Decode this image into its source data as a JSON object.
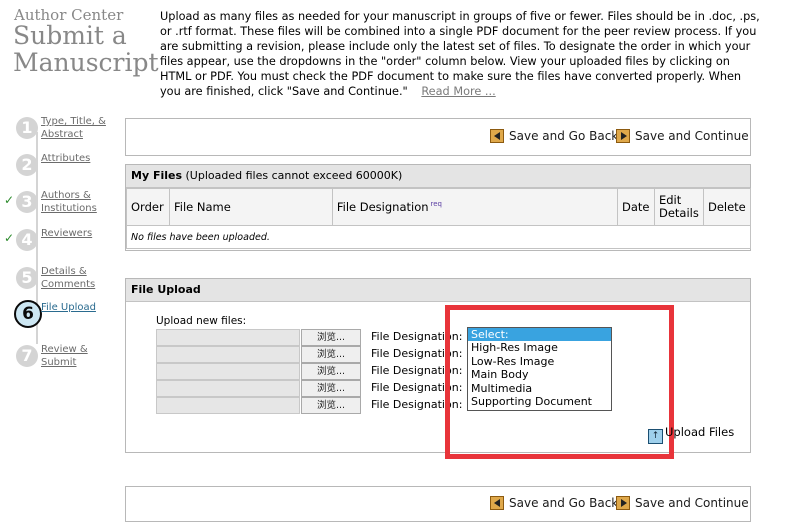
{
  "header": {
    "brand_small": "Author Center",
    "brand_line1": "Submit a",
    "brand_line2": "Manuscript",
    "intro_text": "Upload as many files as needed for your manuscript in groups of five or fewer. Files should be in .doc, .ps, or .rtf format. These files will be combined into a single PDF document for the peer review process. If you are submitting a revision, please include only the latest set of files. To designate the order in which your files appear, use the dropdowns in the \"order\" column below. View your uploaded files by clicking on HTML or PDF. You must check the PDF document to make sure the files have converted properly. When you are finished, click \"Save and Continue.\"",
    "read_more": "Read More ..."
  },
  "steps": [
    {
      "number": "1",
      "label": "Type, Title, & Abstract",
      "checked": false
    },
    {
      "number": "2",
      "label": "Attributes",
      "checked": false
    },
    {
      "number": "3",
      "label": "Authors & Institutions",
      "checked": true
    },
    {
      "number": "4",
      "label": "Reviewers",
      "checked": true
    },
    {
      "number": "5",
      "label": "Details & Comments",
      "checked": false
    },
    {
      "number": "6",
      "label": "File Upload",
      "checked": false,
      "active": true
    },
    {
      "number": "7",
      "label": "Review & Submit",
      "checked": false
    }
  ],
  "actions": {
    "save_back": "Save and Go Back",
    "save_continue": "Save and Continue"
  },
  "my_files": {
    "title": "My Files",
    "subtitle": "(Uploaded files cannot exceed 60000K)",
    "columns": [
      "Order",
      "File Name",
      "File Designation",
      "Date",
      "Edit Details",
      "Delete"
    ],
    "req_badge": "req",
    "empty_message": "No files have been uploaded."
  },
  "file_upload": {
    "title": "File Upload",
    "upload_label": "Upload new files:",
    "browse_label": "浏览...",
    "designation_label": "File Designation:",
    "rows": 5,
    "options": [
      "Select:",
      "High-Res Image",
      "Low-Res Image",
      "Main Body",
      "Multimedia",
      "Supporting Document"
    ],
    "selected_option": "Select:",
    "upload_button": "Upload Files"
  },
  "colors": {
    "highlight": "#e8343a",
    "selected_option": "#39a3e0",
    "check": "#2b8a2b"
  }
}
